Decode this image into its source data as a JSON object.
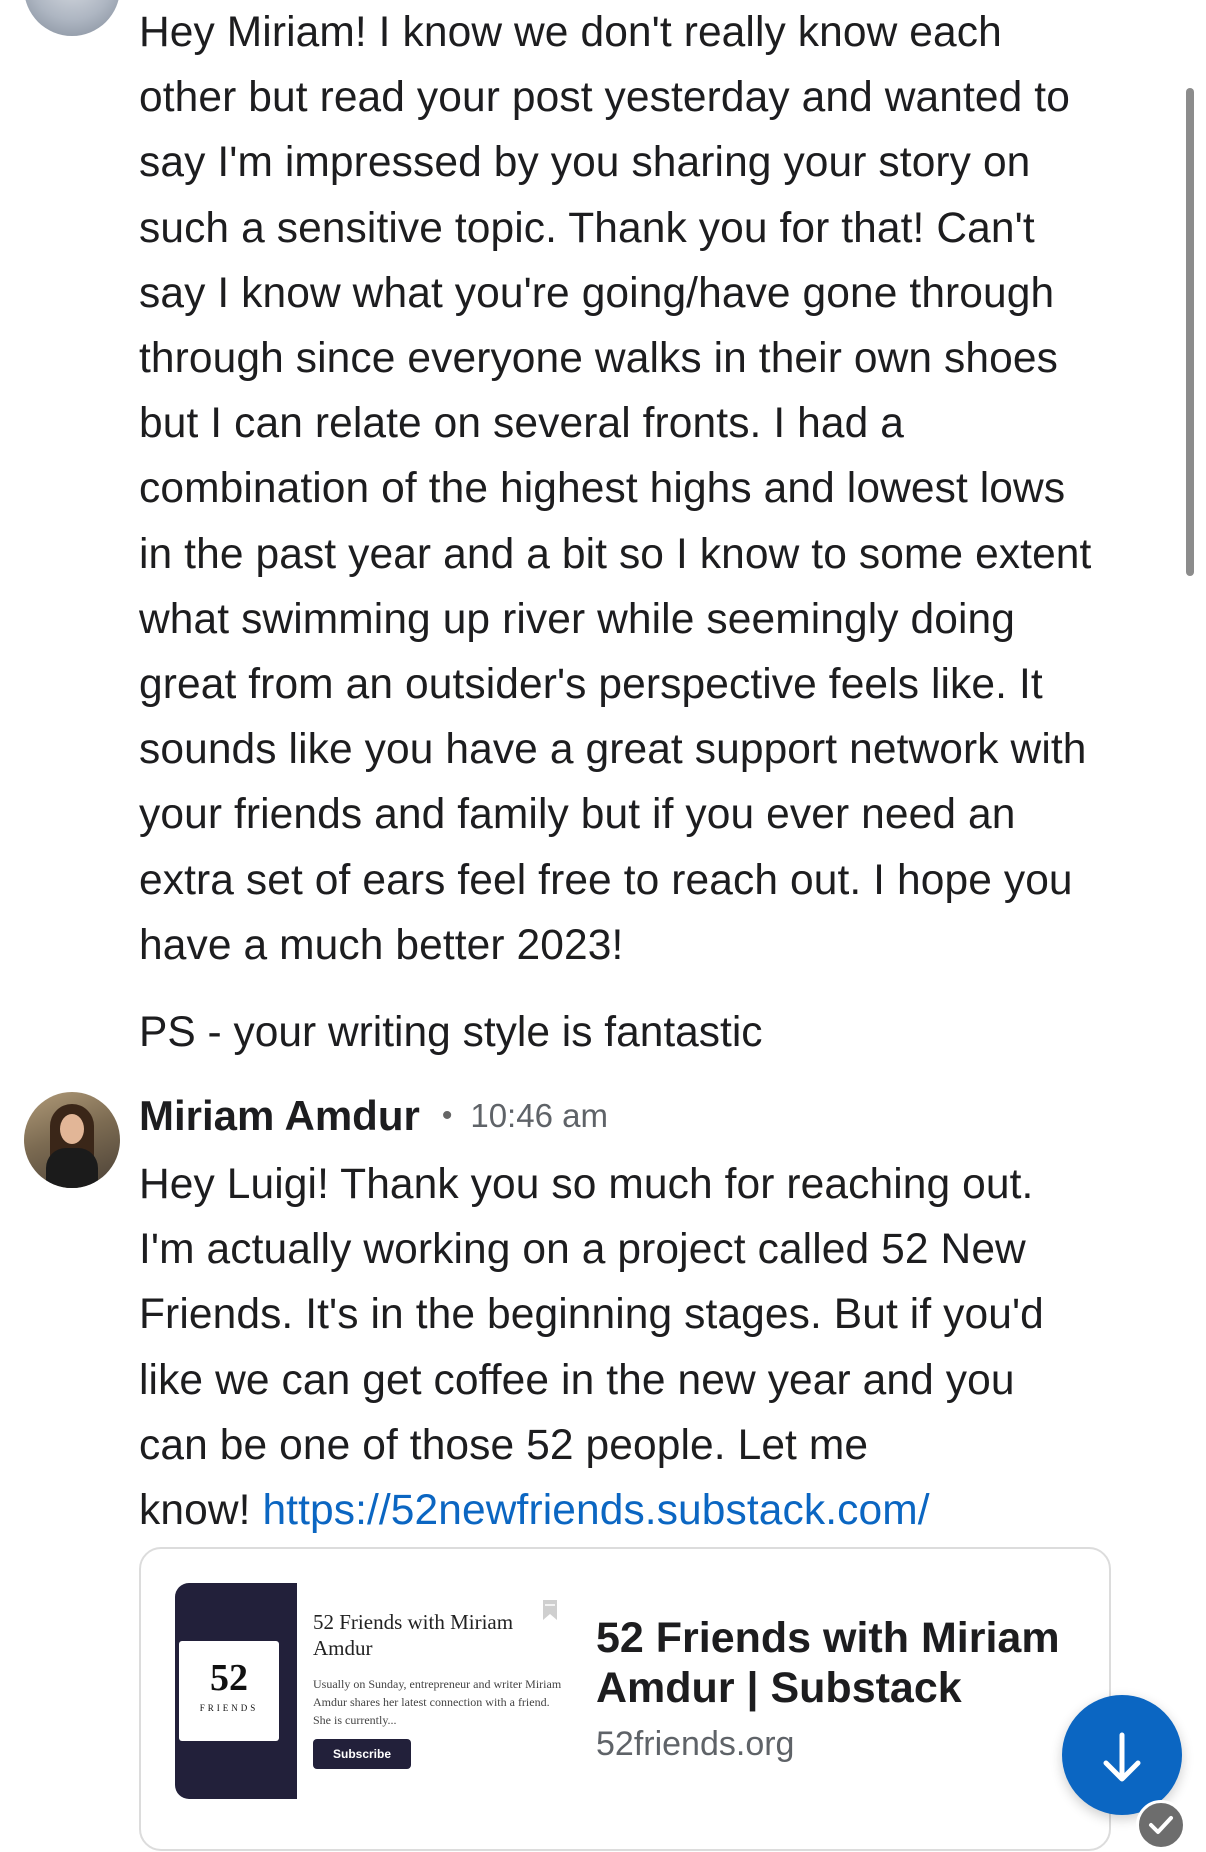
{
  "thread": {
    "previous_message": {
      "lines": [
        "Hey Miriam! I know we don't really know each",
        "other but read your post yesterday and wanted to",
        "say I'm impressed by you sharing your story on",
        "such a sensitive topic. Thank you for that! Can't",
        "say I know what you're going/have gone through",
        "through since everyone walks in their own shoes",
        "but I can relate on several fronts. I had a",
        "combination of the highest highs and lowest lows",
        "in the past year and a bit so I know to some extent",
        "what swimming up river while seemingly doing",
        "great from an outsider's perspective feels like. It",
        "sounds like you have a great support network with",
        "your friends and family but if you ever need an",
        "extra set of ears feel free to reach out. I hope you",
        "have a much better 2023!"
      ],
      "ps": "PS - your writing style is fantastic"
    },
    "reply": {
      "sender": "Miriam Amdur",
      "separator": "•",
      "time": "10:46 am",
      "lines": [
        "Hey Luigi! Thank you so much for reaching out.",
        "I'm actually working on a project called 52 New",
        "Friends. It's in the beginning stages. But if you'd",
        "like we can get coffee in the new year and you",
        "can be one of those 52 people. Let me"
      ],
      "last_line_prefix": "know! ",
      "link": "https://52newfriends.substack.com/"
    },
    "link_preview": {
      "thumbnail": {
        "logo_number": "52",
        "logo_word": "FRIENDS",
        "title": "52 Friends with Miriam Amdur",
        "description": "Usually on Sunday, entrepreneur and writer Miriam Amdur shares her latest connection with a friend. She is currently...",
        "button": "Subscribe"
      },
      "title": "52 Friends with Miriam Amdur | Substack",
      "domain": "52friends.org"
    }
  },
  "icons": {
    "scroll_fab": "arrow-down-icon",
    "badge": "checkmark-icon",
    "bookmark": "bookmark-icon"
  },
  "colors": {
    "link": "#0b66c2",
    "fab": "#0b66c2",
    "thumb_dark": "#22203a"
  }
}
